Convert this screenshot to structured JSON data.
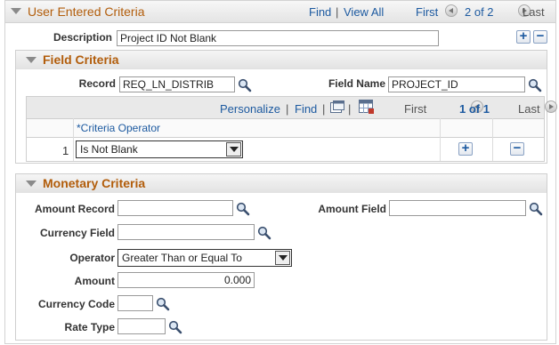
{
  "header": {
    "title": "User Entered Criteria",
    "find": "Find",
    "sep": "|",
    "view_all": "View All",
    "first": "First",
    "page_info": "2 of 2",
    "last": "Last"
  },
  "description": {
    "label": "Description",
    "value": "Project ID Not Blank"
  },
  "field_criteria": {
    "title": "Field Criteria",
    "record_label": "Record",
    "record_value": "REQ_LN_DISTRIB",
    "field_name_label": "Field Name",
    "field_name_value": "PROJECT_ID",
    "grid": {
      "personalize": "Personalize",
      "sep": "|",
      "find": "Find",
      "first": "First",
      "page_info": "1 of 1",
      "last": "Last",
      "column_header": "*Criteria Operator",
      "rows": [
        {
          "num": "1",
          "operator": "Is Not Blank"
        }
      ]
    }
  },
  "monetary_criteria": {
    "title": "Monetary Criteria",
    "amount_record_label": "Amount Record",
    "amount_record_value": "",
    "amount_field_label": "Amount Field",
    "amount_field_value": "",
    "currency_field_label": "Currency Field",
    "currency_field_value": "",
    "operator_label": "Operator",
    "operator_value": "Greater Than or Equal To",
    "amount_label": "Amount",
    "amount_value": "0.000",
    "currency_code_label": "Currency Code",
    "currency_code_value": "",
    "rate_type_label": "Rate Type",
    "rate_type_value": ""
  },
  "colors": {
    "section_title": "#b25d0b",
    "link": "#1d5aa0",
    "header_bg": "#e9e9e9"
  }
}
